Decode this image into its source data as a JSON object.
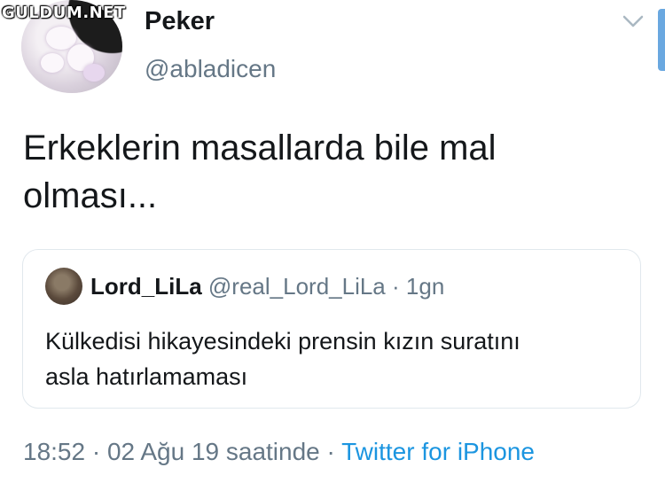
{
  "watermark": "GULDUM.NET",
  "author": {
    "name": "Peker",
    "handle": "@abladicen"
  },
  "tweet": {
    "text_line1": "Erkeklerin masallarda bile mal",
    "text_line2": "olması..."
  },
  "quoted": {
    "name": "Lord_LiLa",
    "handle": "@real_Lord_LiLa",
    "separator": "·",
    "age": "1gn",
    "text_line1": "Külkedisi hikayesindeki prensin kızın suratını",
    "text_line2": "asla hatırlamaması"
  },
  "meta": {
    "time": "18:52",
    "sep1": "·",
    "date": "02 Ağu 19 saatinde",
    "sep2": "·",
    "source": "Twitter for iPhone"
  },
  "icons": {
    "more": "chevron-down-icon"
  },
  "colors": {
    "link": "#1b95e0",
    "secondary_text": "#657786",
    "border": "#e1e8ed"
  }
}
